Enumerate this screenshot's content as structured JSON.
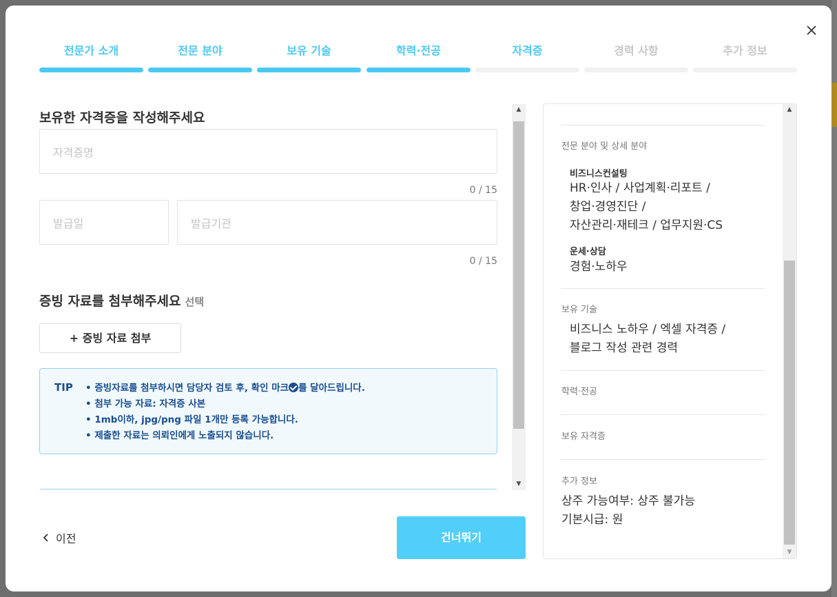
{
  "steps": [
    {
      "label": "전문가 소개",
      "state": "done"
    },
    {
      "label": "전문 분야",
      "state": "done"
    },
    {
      "label": "보유 기술",
      "state": "done"
    },
    {
      "label": "학력·전공",
      "state": "done"
    },
    {
      "label": "자격증",
      "state": "current"
    },
    {
      "label": "경력 사항",
      "state": "todo"
    },
    {
      "label": "추가 정보",
      "state": "todo"
    }
  ],
  "form": {
    "cert_title": "보유한 자격증을 작성해주세요",
    "cert_name_placeholder": "자격증명",
    "cert_name_counter": "0 / 15",
    "issue_date_placeholder": "발급일",
    "issuer_placeholder": "발급기관",
    "issuer_counter": "0 / 15",
    "evidence_title": "증빙 자료를 첨부해주세요",
    "evidence_optional": "선택",
    "attach_button": "+ 증빙 자료 첨부",
    "tip_label": "TIP",
    "tips": {
      "t1_before": "• 증빙자료를 첨부하시면 담당자 검토 후, 확인 마크",
      "t1_after": "를 달아드립니다.",
      "t2": "• 첨부 가능 자료: 자격증 사본",
      "t3": "• 1mb이하, jpg/png 파일 1개만 등록 가능합니다.",
      "t4": "• 제출한 자료는 의뢰인에게 노출되지 않습니다."
    }
  },
  "footer": {
    "prev_label": "이전",
    "skip_label": "건너뛰기"
  },
  "preview": {
    "field_label": "전문 분야 및 상세 분야",
    "cat1": "비즈니스컨설팅",
    "cat1_lines": [
      "HR·인사  / 사업계획·리포트  /",
      "창업·경영진단  /",
      "자산관리·재테크  / 업무지원·CS"
    ],
    "cat2": "운세·상담",
    "cat2_lines": [
      "경험·노하우"
    ],
    "skills_label": "보유 기술",
    "skills_lines": [
      "비즈니스 노하우 / 엑셀 자격증 /",
      "블로그 작성 관련 경력"
    ],
    "edu_label": "학력·전공",
    "cert_label": "보유 자격증",
    "extra_label": "추가 정보",
    "extra_lines": [
      "상주 가능여부: 상주 불가능",
      "기본시급: 원"
    ]
  },
  "colors": {
    "accent": "#4cc9f0",
    "button": "#52cff8",
    "tip_text": "#1a4e8f",
    "tip_bg": "#f1f9fd"
  }
}
